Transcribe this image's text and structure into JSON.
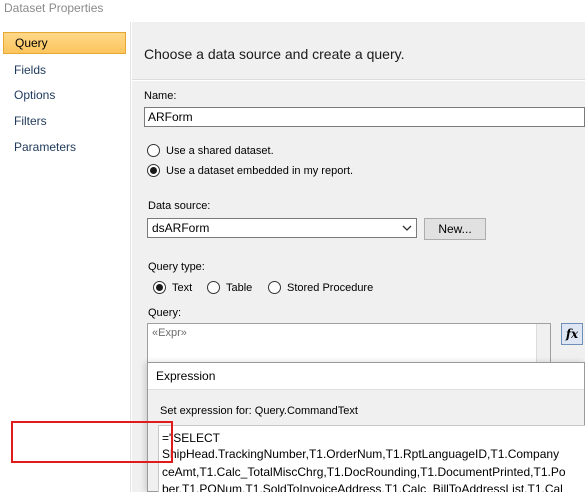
{
  "window": {
    "title": "Dataset Properties"
  },
  "sidebar": {
    "items": [
      {
        "label": "Query",
        "active": true
      },
      {
        "label": "Fields",
        "active": false
      },
      {
        "label": "Options",
        "active": false
      },
      {
        "label": "Filters",
        "active": false
      },
      {
        "label": "Parameters",
        "active": false
      }
    ]
  },
  "page": {
    "heading": "Choose a data source and create a query."
  },
  "name": {
    "label": "Name:",
    "value": "ARForm"
  },
  "dataset_mode": {
    "options": [
      {
        "label": "Use a shared dataset.",
        "selected": false
      },
      {
        "label": "Use a dataset embedded in my report.",
        "selected": true
      }
    ]
  },
  "data_source": {
    "label": "Data source:",
    "value": "dsARForm",
    "new_button": "New..."
  },
  "query_type": {
    "label": "Query type:",
    "options": [
      {
        "label": "Text",
        "selected": true
      },
      {
        "label": "Table",
        "selected": false
      },
      {
        "label": "Stored Procedure",
        "selected": false
      }
    ]
  },
  "query": {
    "label": "Query:",
    "value": "«Expr»",
    "fx_button": "fx"
  },
  "expression_dialog": {
    "title": "Expression",
    "set_label": "Set expression for: Query.CommandText",
    "lines": [
      "=\"SELECT",
      "ShipHead.TrackingNumber,T1.OrderNum,T1.RptLanguageID,T1.Company",
      "ceAmt,T1.Calc_TotalMiscChrg,T1.DocRounding,T1.DocumentPrinted,T1.Po",
      "ber,T1.PONum,T1.SoldToInvoiceAddress,T1.Calc_BillToAddressList,T1.Cal"
    ]
  },
  "colors": {
    "accent": "#fcc55d",
    "highlight": "#e01b1b",
    "panel": "#f0f0f0"
  }
}
